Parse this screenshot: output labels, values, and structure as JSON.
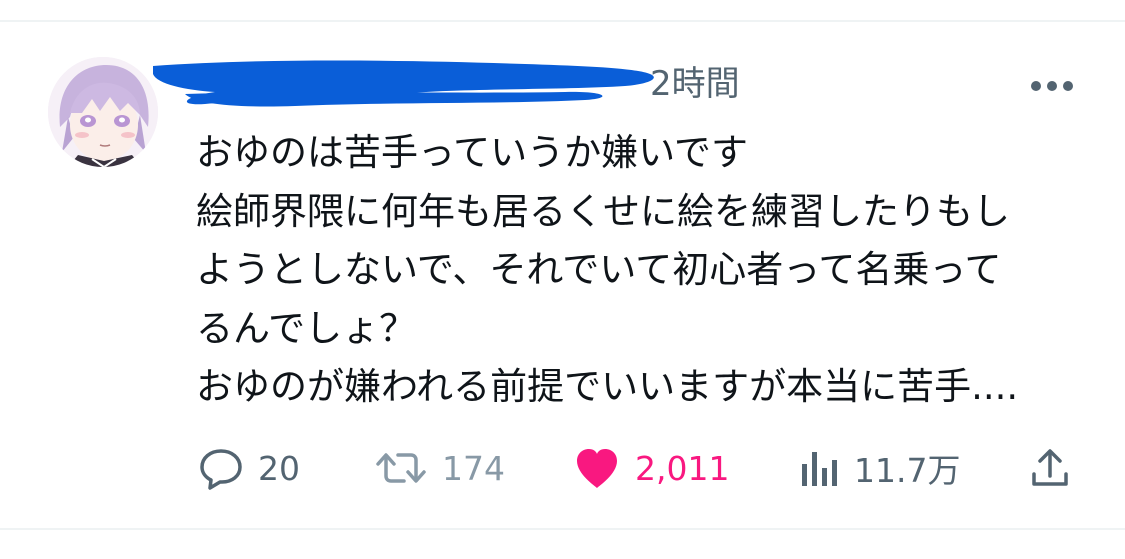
{
  "tweet": {
    "timestamp": "2時間",
    "lines": [
      "おゆのは苦手っていうか嫌いです",
      "絵師界隈に何年も居るくせに絵を練習したりもし",
      "ようとしないで、それでいて初心者って名乗って",
      "るんでしょ？",
      "おゆのが嫌われる前提でいいますが本当に苦手...."
    ]
  },
  "actions": {
    "reply": {
      "icon": "reply-bubble-icon",
      "count": "20"
    },
    "retweet": {
      "icon": "retweet-icon",
      "count": "174"
    },
    "like": {
      "icon": "heart-filled-icon",
      "count": "2,011",
      "liked": true
    },
    "views": {
      "icon": "analytics-bars-icon",
      "count": "11.7万"
    },
    "share": {
      "icon": "share-upload-icon"
    }
  },
  "colors": {
    "text": "#0f1419",
    "secondary": "#536471",
    "like": "#f91880",
    "redaction": "#0a5ed8",
    "divider": "#eff3f4"
  }
}
